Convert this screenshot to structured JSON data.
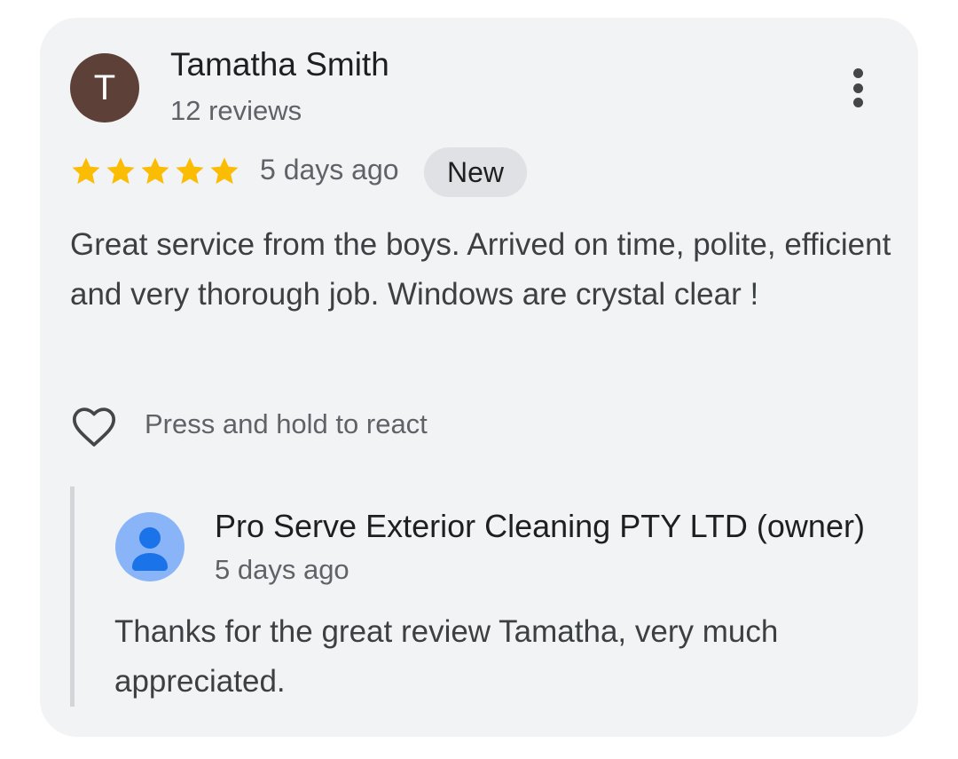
{
  "review": {
    "avatar_initial": "T",
    "avatar_color": "#5d4037",
    "reviewer_name": "Tamatha Smith",
    "review_count": "12 reviews",
    "rating": 5,
    "max_rating": 5,
    "star_color": "#fbbc04",
    "date": "5 days ago",
    "badge": "New",
    "text": "Great service from the boys. Arrived on time, polite, efficient and very thorough job. Windows are crystal clear !",
    "react_hint": "Press and hold to react",
    "icons": {
      "more": "more-vert-icon",
      "react": "heart-outline-icon"
    }
  },
  "reply": {
    "owner_name": "Pro Serve Exterior Cleaning PTY LTD (owner)",
    "date": "5 days ago",
    "text": "Thanks for the great review Tamatha, very much appreciated.",
    "avatar_icon": "default-person-avatar-icon",
    "avatar_colors": {
      "background": "#8ab4f8",
      "figure": "#1a73e8"
    }
  }
}
